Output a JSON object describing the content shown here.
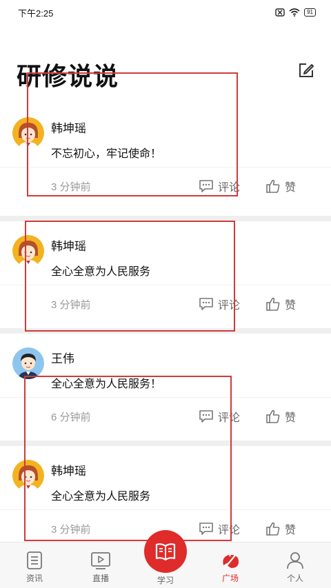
{
  "status_bar": {
    "time": "下午2:25",
    "battery": "91"
  },
  "header": {
    "title": "研修说说",
    "edit_icon": "edit-icon"
  },
  "posts": [
    {
      "author": "韩坤瑶",
      "content": "不忘初心，牢记使命！",
      "time": "3 分钟前",
      "comment_label": "评论",
      "like_label": "赞",
      "avatar": "female"
    },
    {
      "author": "韩坤瑶",
      "content": "全心全意为人民服务",
      "time": "3 分钟前",
      "comment_label": "评论",
      "like_label": "赞",
      "avatar": "female"
    },
    {
      "author": "王伟",
      "content": "全心全意为人民服务！",
      "time": "6 分钟前",
      "comment_label": "评论",
      "like_label": "赞",
      "avatar": "male"
    },
    {
      "author": "韩坤瑶",
      "content": "全心全意为人民服务",
      "time": "3 分钟前",
      "comment_label": "评论",
      "like_label": "赞",
      "avatar": "female"
    }
  ],
  "tabbar": {
    "items": [
      {
        "label": "资讯",
        "icon": "news-icon"
      },
      {
        "label": "直播",
        "icon": "live-icon"
      },
      {
        "label": "学习",
        "icon": "book-icon"
      },
      {
        "label": "广场",
        "icon": "square-icon",
        "active": true
      },
      {
        "label": "个人",
        "icon": "user-icon"
      }
    ]
  },
  "colors": {
    "accent": "#e02b2b",
    "annotation": "#d0393a",
    "separator": "#efefef"
  }
}
